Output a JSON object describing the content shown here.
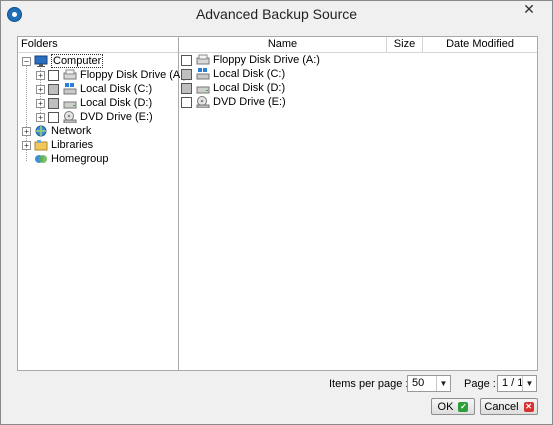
{
  "window": {
    "title": "Advanced Backup Source",
    "close_glyph": "✕"
  },
  "folders": {
    "header": "Folders",
    "tree": [
      {
        "label": "Computer",
        "icon": "computer-icon",
        "expander": "−"
      },
      {
        "label": "Floppy Disk Drive (A:)",
        "icon": "floppy-drive-icon",
        "expander": "+"
      },
      {
        "label": "Local Disk (C:)",
        "icon": "local-disk-c-icon",
        "expander": "+"
      },
      {
        "label": "Local Disk (D:)",
        "icon": "local-disk-d-icon",
        "expander": "+"
      },
      {
        "label": "DVD Drive (E:)",
        "icon": "dvd-drive-icon",
        "expander": "+"
      },
      {
        "label": "Network",
        "icon": "network-icon",
        "expander": "+"
      },
      {
        "label": "Libraries",
        "icon": "libraries-icon",
        "expander": "+"
      },
      {
        "label": "Homegroup",
        "icon": "homegroup-icon",
        "expander": ""
      }
    ]
  },
  "content": {
    "columns": {
      "name": "Name",
      "size": "Size",
      "date_modified": "Date Modified"
    },
    "rows": [
      {
        "name": "Floppy Disk Drive (A:)"
      },
      {
        "name": "Local Disk (C:)"
      },
      {
        "name": "Local Disk (D:)"
      },
      {
        "name": "DVD Drive (E:)"
      }
    ]
  },
  "pager": {
    "items_per_page_label": "Items per page :",
    "items_per_page_value": "50",
    "page_label": "Page :",
    "page_value": "1 / 1"
  },
  "buttons": {
    "ok": "OK",
    "cancel": "Cancel"
  },
  "colors": {
    "accent": "#1e6fb8",
    "ok_mark": "#2e9e3a",
    "cancel_mark": "#d93030"
  }
}
